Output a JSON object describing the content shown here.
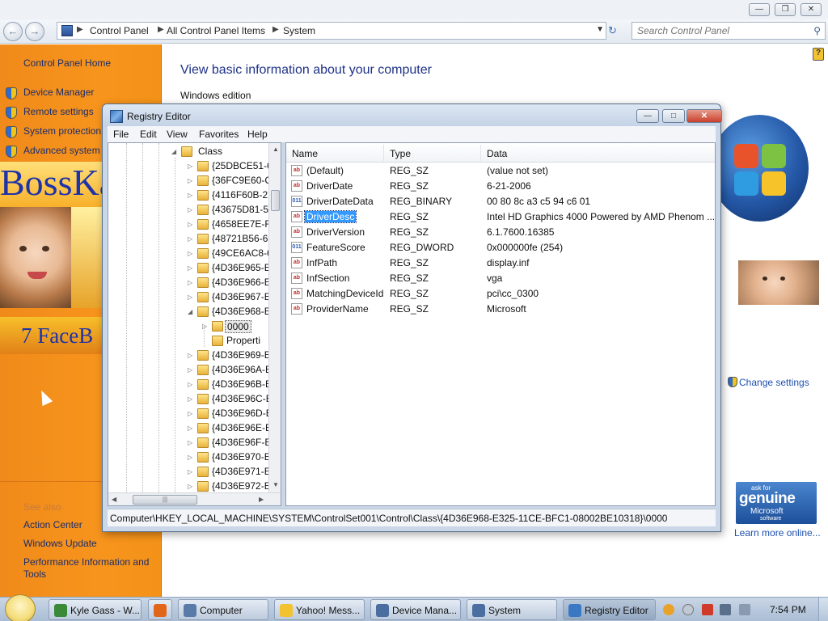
{
  "control_panel": {
    "breadcrumbs": [
      "Control Panel",
      "All Control Panel Items",
      "System"
    ],
    "search_placeholder": "Search Control Panel",
    "sidebar": {
      "home": "Control Panel Home",
      "links": [
        "Device Manager",
        "Remote settings",
        "System protection",
        "Advanced system"
      ],
      "see_also_heading": "See also",
      "see_also_links": [
        "Action Center",
        "Windows Update",
        "Performance Information and",
        "Tools"
      ],
      "banner_text": "BossKa",
      "facebook_text": "7 FaceB"
    },
    "main": {
      "title": "View basic information about your computer",
      "section": "Windows edition",
      "change_settings": "Change settings",
      "genuine": {
        "ask_for": "ask for",
        "genuine": "genuine",
        "microsoft": "Microsoft",
        "software": "software"
      },
      "learn_more": "Learn more online..."
    }
  },
  "registry_editor": {
    "title": "Registry Editor",
    "menu": [
      "File",
      "Edit",
      "View",
      "Favorites",
      "Help"
    ],
    "tree": {
      "root": "Class",
      "keys": [
        "{25DBCE51-6",
        "{36FC9E60-C",
        "{4116F60B-2",
        "{43675D81-5",
        "{4658EE7E-F0",
        "{48721B56-6",
        "{49CE6AC8-6",
        "{4D36E965-E",
        "{4D36E966-E",
        "{4D36E967-E",
        "{4D36E968-E"
      ],
      "subkeys": [
        "0000",
        "Properti"
      ],
      "keys_after": [
        "{4D36E969-E",
        "{4D36E96A-E",
        "{4D36E96B-E",
        "{4D36E96C-E",
        "{4D36E96D-E",
        "{4D36E96E-E",
        "{4D36E96F-E",
        "{4D36E970-E",
        "{4D36E971-E",
        "{4D36E972-E"
      ]
    },
    "columns": [
      "Name",
      "Type",
      "Data"
    ],
    "values": [
      {
        "name": "(Default)",
        "type": "REG_SZ",
        "data": "(value not set)",
        "icon": "string-value-icon"
      },
      {
        "name": "DriverDate",
        "type": "REG_SZ",
        "data": "6-21-2006",
        "icon": "string-value-icon"
      },
      {
        "name": "DriverDateData",
        "type": "REG_BINARY",
        "data": "00 80 8c a3 c5 94 c6 01",
        "icon": "binary-value-icon"
      },
      {
        "name": "DriverDesc",
        "type": "REG_SZ",
        "data": "Intel HD Graphics 4000 Powered by AMD Phenom ...",
        "icon": "string-value-icon",
        "selected": true
      },
      {
        "name": "DriverVersion",
        "type": "REG_SZ",
        "data": "6.1.7600.16385",
        "icon": "string-value-icon"
      },
      {
        "name": "FeatureScore",
        "type": "REG_DWORD",
        "data": "0x000000fe (254)",
        "icon": "binary-value-icon"
      },
      {
        "name": "InfPath",
        "type": "REG_SZ",
        "data": "display.inf",
        "icon": "string-value-icon"
      },
      {
        "name": "InfSection",
        "type": "REG_SZ",
        "data": "vga",
        "icon": "string-value-icon"
      },
      {
        "name": "MatchingDeviceId",
        "type": "REG_SZ",
        "data": "pci\\cc_0300",
        "icon": "string-value-icon"
      },
      {
        "name": "ProviderName",
        "type": "REG_SZ",
        "data": "Microsoft",
        "icon": "string-value-icon"
      }
    ],
    "status_path": "Computer\\HKEY_LOCAL_MACHINE\\SYSTEM\\ControlSet001\\Control\\Class\\{4D36E968-E325-11CE-BFC1-08002BE10318}\\0000"
  },
  "taskbar": {
    "buttons": [
      {
        "label": "Kyle Gass - W...",
        "icon": "chrome-icon",
        "color": "#3a8a3a"
      },
      {
        "label": "",
        "icon": "firefox-icon",
        "color": "#e2661a"
      },
      {
        "label": "Computer",
        "icon": "computer-icon",
        "color": "#5a7aa8"
      },
      {
        "label": "Yahoo! Mess...",
        "icon": "yahoo-messenger-icon",
        "color": "#f2c231"
      },
      {
        "label": "Device Mana...",
        "icon": "device-manager-icon",
        "color": "#4a6ea0"
      },
      {
        "label": "System",
        "icon": "system-icon",
        "color": "#4a6ea0"
      },
      {
        "label": "Registry Editor",
        "icon": "registry-editor-icon",
        "color": "#3a78c4"
      }
    ],
    "clock": "7:54 PM"
  },
  "colors": {
    "sidebar_orange": "#f7941d",
    "link_blue": "#1e4fb0",
    "title_blue": "#1e3287",
    "selection_blue": "#3399ff"
  }
}
